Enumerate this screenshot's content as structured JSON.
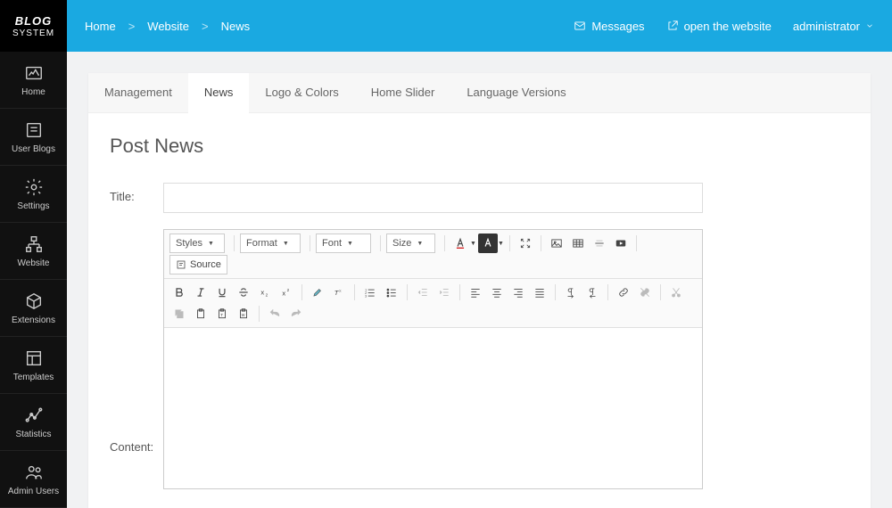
{
  "logo": {
    "top": "BLOG",
    "bottom": "SYSTEM"
  },
  "sidebar": {
    "items": [
      {
        "label": "Home"
      },
      {
        "label": "User Blogs"
      },
      {
        "label": "Settings"
      },
      {
        "label": "Website"
      },
      {
        "label": "Extensions"
      },
      {
        "label": "Templates"
      },
      {
        "label": "Statistics"
      },
      {
        "label": "Admin Users"
      }
    ]
  },
  "breadcrumb": [
    "Home",
    "Website",
    "News"
  ],
  "topbar": {
    "messages": "Messages",
    "open": "open the website",
    "user": "administrator"
  },
  "tabs": [
    "Management",
    "News",
    "Logo & Colors",
    "Home Slider",
    "Language Versions"
  ],
  "page": {
    "title": "Post News",
    "labels": {
      "title": "Title:",
      "content": "Content:"
    }
  },
  "editor": {
    "combos": {
      "styles": "Styles",
      "format": "Format",
      "font": "Font",
      "size": "Size"
    },
    "source": "Source"
  }
}
